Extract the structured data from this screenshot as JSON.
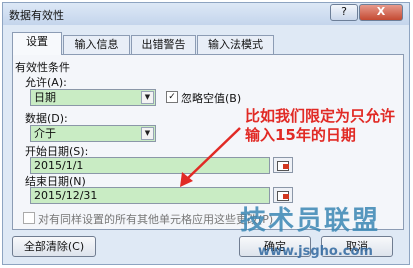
{
  "window": {
    "title": "数据有效性",
    "help_glyph": "?",
    "close_glyph": "X"
  },
  "tabs": [
    {
      "label": "设置",
      "active": true
    },
    {
      "label": "输入信息",
      "active": false
    },
    {
      "label": "出错警告",
      "active": false
    },
    {
      "label": "输入法模式",
      "active": false
    }
  ],
  "validation": {
    "section_title": "有效性条件",
    "allow_label": "允许(A):",
    "allow_value": "日期",
    "ignore_blank_label": "忽略空值(B)",
    "ignore_blank_checked": true,
    "data_label": "数据(D):",
    "data_value": "介于",
    "start_label": "开始日期(S):",
    "start_value": "2015/1/1",
    "end_label": "结束日期(N)",
    "end_value": "2015/12/31",
    "apply_all_label": "对有同样设置的所有其他单元格应用这些更改(P)",
    "apply_all_checked": false
  },
  "buttons": {
    "clear_all": "全部清除(C)",
    "ok": "确定",
    "cancel": "取消"
  },
  "annotation": {
    "line1": "比如我们限定为只允许",
    "line2": "输入15年的日期",
    "color": "#e12a25"
  },
  "watermark": {
    "text": "技术员联盟",
    "url": "www.jsgho.com"
  }
}
